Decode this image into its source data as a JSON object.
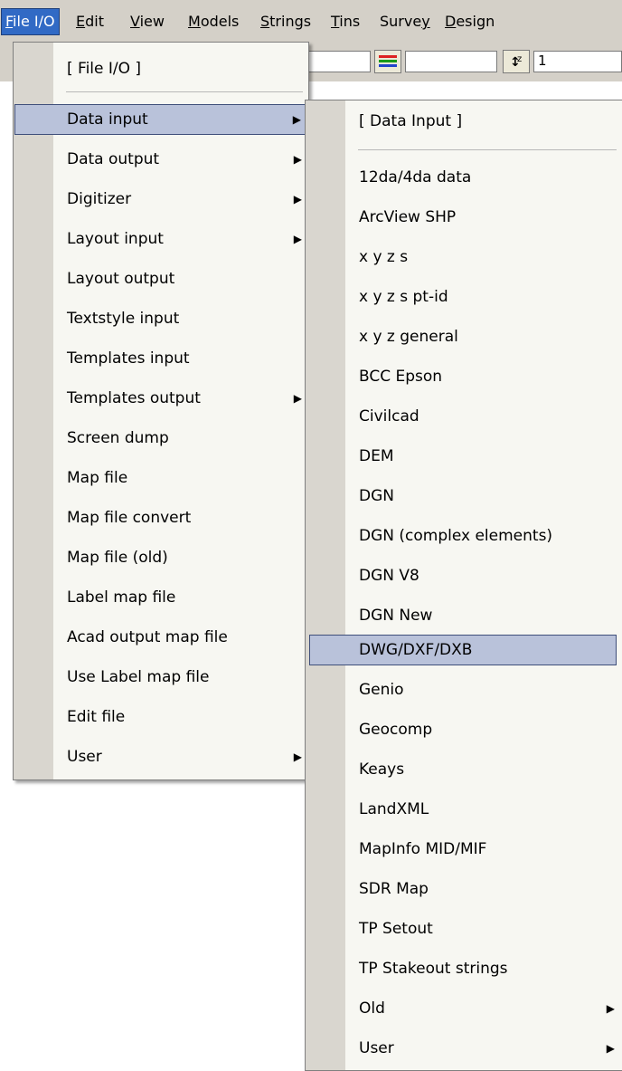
{
  "menubar": {
    "items": [
      {
        "accel": "F",
        "rest": "ile I/O"
      },
      {
        "accel": "E",
        "rest": "dit"
      },
      {
        "accel": "V",
        "rest": "iew"
      },
      {
        "accel": "M",
        "rest": "odels"
      },
      {
        "accel": "S",
        "rest": "trings"
      },
      {
        "accel": "T",
        "rest": "ins"
      },
      {
        "pre": "Surve",
        "accel": "y",
        "rest": ""
      },
      {
        "accel": "D",
        "rest": "esign"
      }
    ]
  },
  "toolbar": {
    "value_field": "1"
  },
  "file_menu": {
    "title": "[ File I/O ]",
    "items": [
      {
        "label": "Data input"
      },
      {
        "label": "Data output"
      },
      {
        "label": "Digitizer"
      },
      {
        "label": "Layout input"
      },
      {
        "label": "Layout output"
      },
      {
        "label": "Textstyle input"
      },
      {
        "label": "Templates input"
      },
      {
        "label": "Templates output"
      },
      {
        "label": "Screen dump"
      },
      {
        "label": "Map file"
      },
      {
        "label": "Map file convert"
      },
      {
        "label": "Map file (old)"
      },
      {
        "label": "Label map file"
      },
      {
        "label": "Acad output map file"
      },
      {
        "label": "Use Label map file"
      },
      {
        "label": "Edit file"
      },
      {
        "label": "User"
      }
    ],
    "submenu_arrow": "▶"
  },
  "data_input_menu": {
    "title": "[ Data Input ]",
    "items": [
      {
        "label": "12da/4da data"
      },
      {
        "label": "ArcView SHP"
      },
      {
        "label": "x y z s"
      },
      {
        "label": "x y z s pt-id"
      },
      {
        "label": "x y z general"
      },
      {
        "label": "BCC Epson"
      },
      {
        "label": "Civilcad"
      },
      {
        "label": "DEM"
      },
      {
        "label": "DGN"
      },
      {
        "label": "DGN (complex elements)"
      },
      {
        "label": "DGN V8"
      },
      {
        "label": "DGN New"
      },
      {
        "label": "DWG/DXF/DXB"
      },
      {
        "label": "Genio"
      },
      {
        "label": "Geocomp"
      },
      {
        "label": "Keays"
      },
      {
        "label": "LandXML"
      },
      {
        "label": "MapInfo MID/MIF"
      },
      {
        "label": "SDR Map"
      },
      {
        "label": "TP Setout"
      },
      {
        "label": "TP Stakeout strings"
      },
      {
        "label": "Old"
      },
      {
        "label": "User"
      }
    ]
  }
}
